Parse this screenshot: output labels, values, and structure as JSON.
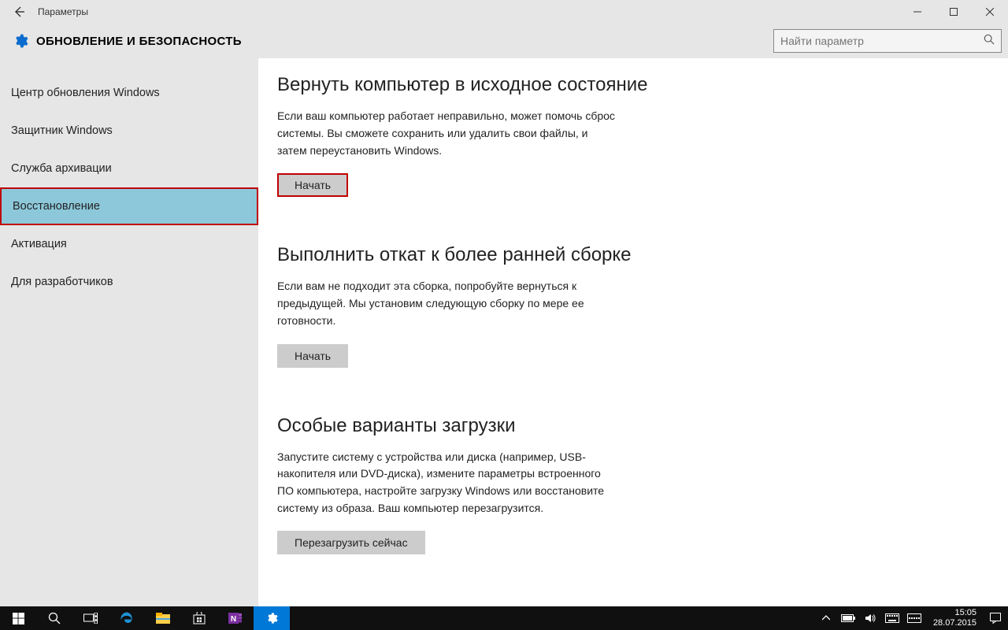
{
  "window": {
    "title": "Параметры",
    "section": "ОБНОВЛЕНИЕ И БЕЗОПАСНОСТЬ",
    "search_placeholder": "Найти параметр"
  },
  "sidebar": {
    "items": [
      {
        "label": "Центр обновления Windows"
      },
      {
        "label": "Защитник Windows"
      },
      {
        "label": "Служба архивации"
      },
      {
        "label": "Восстановление"
      },
      {
        "label": "Активация"
      },
      {
        "label": "Для разработчиков"
      }
    ],
    "selected_index": 3
  },
  "content": {
    "reset": {
      "heading": "Вернуть компьютер в исходное состояние",
      "text": "Если ваш компьютер работает неправильно, может помочь сброс системы. Вы сможете сохранить или удалить свои файлы, и затем переустановить Windows.",
      "button": "Начать"
    },
    "rollback": {
      "heading": "Выполнить откат к более ранней сборке",
      "text": "Если вам не подходит эта сборка, попробуйте вернуться к предыдущей. Мы установим следующую сборку по мере ее готовности.",
      "button": "Начать"
    },
    "advanced": {
      "heading": "Особые варианты загрузки",
      "text": "Запустите систему с устройства или диска (например, USB-накопителя или DVD-диска), измените параметры встроенного ПО компьютера, настройте загрузку Windows или восстановите систему из образа. Ваш компьютер перезагрузится.",
      "button": "Перезагрузить сейчас"
    }
  },
  "taskbar": {
    "time": "15:05",
    "date": "28.07.2015"
  }
}
